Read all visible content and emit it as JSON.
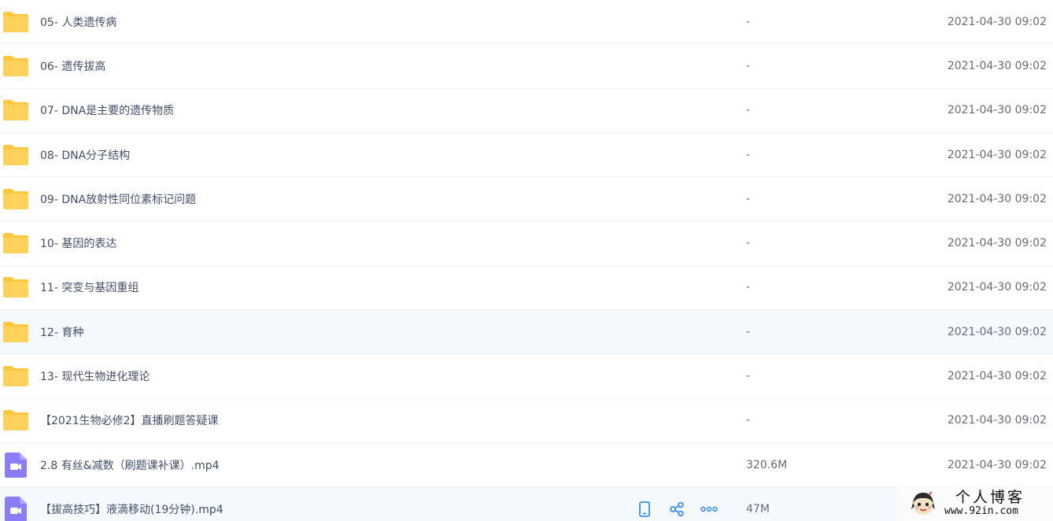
{
  "files": [
    {
      "name": "05- 人类遗传病",
      "type": "folder",
      "size": "-",
      "date": "2021-04-30 09:02"
    },
    {
      "name": "06- 遗传拔高",
      "type": "folder",
      "size": "-",
      "date": "2021-04-30 09:02"
    },
    {
      "name": "07- DNA是主要的遗传物质",
      "type": "folder",
      "size": "-",
      "date": "2021-04-30 09:02"
    },
    {
      "name": "08- DNA分子结构",
      "type": "folder",
      "size": "-",
      "date": "2021-04-30 09:02"
    },
    {
      "name": "09- DNA放射性同位素标记问题",
      "type": "folder",
      "size": "-",
      "date": "2021-04-30 09:02"
    },
    {
      "name": "10- 基因的表达",
      "type": "folder",
      "size": "-",
      "date": "2021-04-30 09:02"
    },
    {
      "name": "11- 突变与基因重组",
      "type": "folder",
      "size": "-",
      "date": "2021-04-30 09:02"
    },
    {
      "name": "12- 育种",
      "type": "folder",
      "size": "-",
      "date": "2021-04-30 09:02"
    },
    {
      "name": "13- 现代生物进化理论",
      "type": "folder",
      "size": "-",
      "date": "2021-04-30 09:02"
    },
    {
      "name": "【2021生物必修2】直播刷题答疑课",
      "type": "folder",
      "size": "-",
      "date": "2021-04-30 09:02"
    },
    {
      "name": "2.8 有丝&减数（刷题课补课）.mp4",
      "type": "video",
      "size": "320.6M",
      "date": "2021-04-30 09:02"
    },
    {
      "name": "【拔高技巧】液滴移动(19分钟).mp4",
      "type": "video",
      "size": "47M",
      "date": ""
    }
  ],
  "watermark": {
    "title": "个人博客",
    "url": "www.92in.com"
  },
  "colors": {
    "folder": "#ffd35b",
    "folder_back": "#ffc63f",
    "video": "#8a7df5",
    "action": "#3b8cf2",
    "hover_row": "#f4f9fe"
  },
  "icons": {
    "folder": "folder-icon",
    "video": "video-file-icon",
    "actions": [
      "phone-icon",
      "share-icon",
      "more-icon"
    ]
  }
}
